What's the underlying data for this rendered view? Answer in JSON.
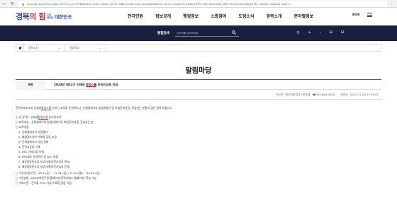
{
  "browser": {
    "url": "www.gb.go.kr/Main/page.do?mnu_uid=6786&dept_code=&dept_name=&BD_CODE=bbs_gongji&bdBlame=&cmd=2&Start=10&B_NUM=358140001&B_STEP=358140000&B_LEVEL=0&key=4&word=&p1=...",
    "back_icon": "arrow-left-icon",
    "forward_icon": "arrow-right-icon",
    "reload_icon": "reload-icon",
    "menu_icon": "more-icon"
  },
  "header": {
    "logo_part1": "경북",
    "logo_part2": "의 힘",
    "logo_sub1": "으로",
    "logo_sub2": "새로운",
    "logo_brand": "대한민국",
    "nav": [
      "전자민원",
      "정보공개",
      "행정정보",
      "소통참여",
      "도정소식",
      "경북소개",
      "분야별정보"
    ],
    "lang": "KOR"
  },
  "search": {
    "label": "통합검색",
    "placeholder": "검색어를 입력하세요"
  },
  "a11y": {
    "items": [
      "가",
      "+",
      "-",
      "⊞",
      "⊟"
    ]
  },
  "breadcrumb": {
    "items": [
      "경북소식",
      "알림마당"
    ]
  },
  "page": {
    "title": "알림마당"
  },
  "post": {
    "subject_head": "제목",
    "subject_pre": "2023년 제12기 신재생 ",
    "subject_hl": "창업스쿨",
    "subject_post": " 온라인교육 안내",
    "author_label": "작성자",
    "author": "에너지산업과 | 손호영",
    "phone": "☎054-880-7640",
    "date_label": "등록일",
    "date": "2023-11-20 13:39:01"
  },
  "content": {
    "intro_pre": "전력거래소에서 신재생",
    "intro_hl": "창업스쿨",
    "intro_post": " 온라인 교육을 운영하오니, 신재생에너지 창업희망자 및 취업준비생 등 관심있는 분들의 많은 참여 바랍니다.",
    "course_pre": "○ 과 정 명 : 신재생",
    "course_hl": "창업스쿨",
    "course_post": " 온라인교육",
    "target": "○ 교육대상 : 신재생에너지 창업희망자 및 취업준비생 등 관심있는 분",
    "subject_title": "○ 교육내용",
    "subjects": [
      "1. 신재생에너지 사업절차",
      "2. 태양광조사의 이해와 공동 조달",
      "3. 신재생에너지 사업 경제",
      "4. 전력시장의 이해",
      "5. REC 거래시장 이해",
      "6. RPS제도 분석학인 및 REC 발급",
      "7. 태양광발전사업 실무사례(발전사업의 관리)",
      "8. 태양광발전사업 실무사례(발전사업의 운영)"
    ],
    "period": "○ 수강(신청)기간 : 12.1.(금) ~ 12.31.(일) / 11.20.(월) ~ 12.10.(일)",
    "method": "○ 수강방법 : KPX교육연구원 홈페이지(전력거래소 웹페이지) 학습 가능",
    "completion": "○ 수료기준 : 진도율 70% 이상(수료증 발급 가능)"
  }
}
